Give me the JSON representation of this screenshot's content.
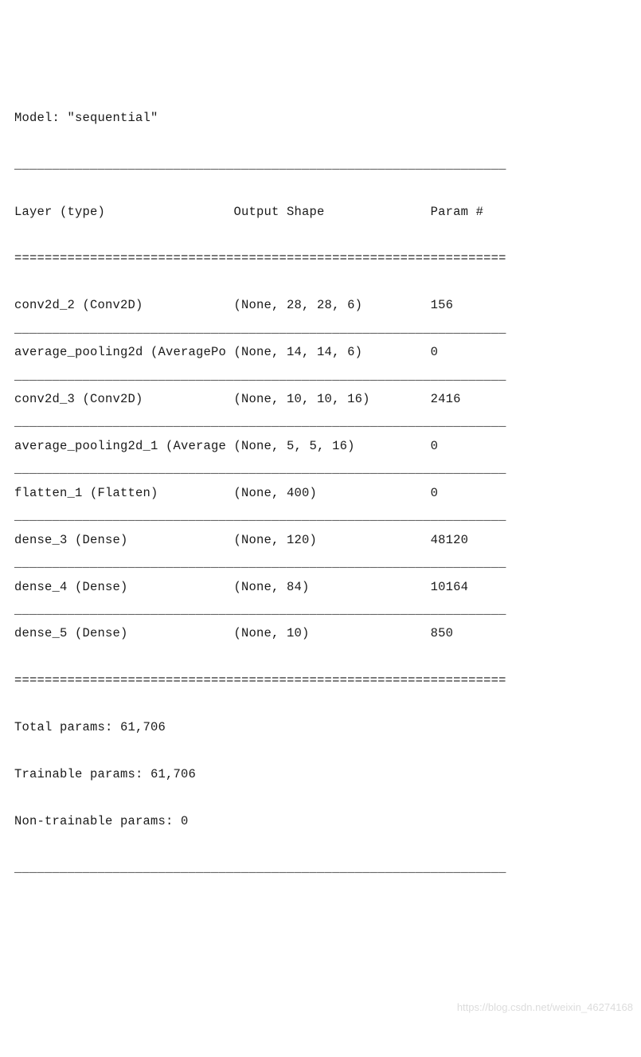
{
  "model_line": "Model: \"sequential\"",
  "header": {
    "layer": "Layer (type)",
    "output": "Output Shape",
    "params": "Param #"
  },
  "rows": [
    {
      "layer": "conv2d_2 (Conv2D)",
      "output": "(None, 28, 28, 6)",
      "params": "156"
    },
    {
      "layer": "average_pooling2d (AveragePo",
      "output": "(None, 14, 14, 6)",
      "params": "0"
    },
    {
      "layer": "conv2d_3 (Conv2D)",
      "output": "(None, 10, 10, 16)",
      "params": "2416"
    },
    {
      "layer": "average_pooling2d_1 (Average",
      "output": "(None, 5, 5, 16)",
      "params": "0"
    },
    {
      "layer": "flatten_1 (Flatten)",
      "output": "(None, 400)",
      "params": "0"
    },
    {
      "layer": "dense_3 (Dense)",
      "output": "(None, 120)",
      "params": "48120"
    },
    {
      "layer": "dense_4 (Dense)",
      "output": "(None, 84)",
      "params": "10164"
    },
    {
      "layer": "dense_5 (Dense)",
      "output": "(None, 10)",
      "params": "850"
    }
  ],
  "totals": {
    "total": "Total params: 61,706",
    "trainable": "Trainable params: 61,706",
    "nontrainable": "Non-trainable params: 0"
  },
  "watermark": "https://blog.csdn.net/weixin_46274168",
  "chart_data": {
    "type": "table",
    "title": "Model: \"sequential\"",
    "columns": [
      "Layer (type)",
      "Output Shape",
      "Param #"
    ],
    "rows": [
      [
        "conv2d_2 (Conv2D)",
        "(None, 28, 28, 6)",
        156
      ],
      [
        "average_pooling2d (AveragePo",
        "(None, 14, 14, 6)",
        0
      ],
      [
        "conv2d_3 (Conv2D)",
        "(None, 10, 10, 16)",
        2416
      ],
      [
        "average_pooling2d_1 (Average",
        "(None, 5, 5, 16)",
        0
      ],
      [
        "flatten_1 (Flatten)",
        "(None, 400)",
        0
      ],
      [
        "dense_3 (Dense)",
        "(None, 120)",
        48120
      ],
      [
        "dense_4 (Dense)",
        "(None, 84)",
        10164
      ],
      [
        "dense_5 (Dense)",
        "(None, 10)",
        850
      ]
    ],
    "summary": {
      "Total params": 61706,
      "Trainable params": 61706,
      "Non-trainable params": 0
    }
  }
}
